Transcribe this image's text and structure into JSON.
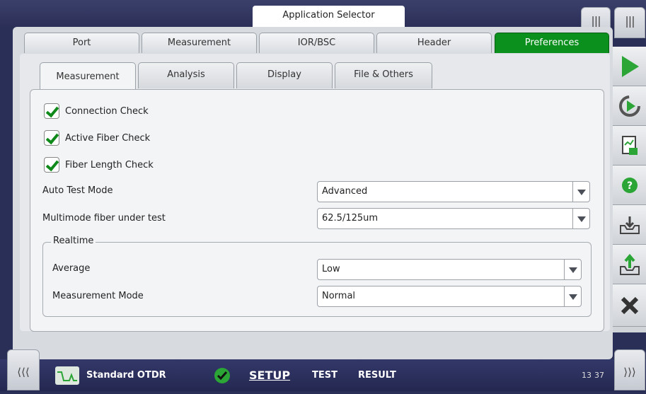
{
  "app_selector": {
    "label": "Application Selector"
  },
  "handles": {
    "top_left": "|||",
    "top_right": "|||",
    "bottom_left": "⟨⟨⟨",
    "bottom_right": "⟩⟩⟩"
  },
  "main_tabs": [
    {
      "label": "Port"
    },
    {
      "label": "Measurement"
    },
    {
      "label": "IOR/BSC"
    },
    {
      "label": "Header"
    },
    {
      "label": "Preferences",
      "active": true
    }
  ],
  "sub_tabs": [
    {
      "label": "Measurement",
      "active": true
    },
    {
      "label": "Analysis"
    },
    {
      "label": "Display"
    },
    {
      "label": "File & Others"
    }
  ],
  "checks": [
    {
      "label": "Connection Check",
      "checked": true
    },
    {
      "label": "Active Fiber Check",
      "checked": true
    },
    {
      "label": "Fiber Length Check",
      "checked": true
    }
  ],
  "auto_test_mode": {
    "label": "Auto Test Mode",
    "value": "Advanced"
  },
  "multimode": {
    "label": "Multimode fiber under test",
    "value": "62.5/125um"
  },
  "realtime": {
    "title": "Realtime",
    "average": {
      "label": "Average",
      "value": "Low"
    },
    "measurement_mode": {
      "label": "Measurement Mode",
      "value": "Normal"
    }
  },
  "right_toolbar": [
    "play-icon",
    "refresh-play-icon",
    "report-icon",
    "help-icon",
    "load-icon",
    "save-icon",
    "close-icon"
  ],
  "bottom": {
    "app_name": "Standard OTDR",
    "setup": "SETUP",
    "test": "TEST",
    "result": "RESULT",
    "time_h": "13",
    "time_m": "37"
  },
  "colors": {
    "accent_green": "#0b8f1d",
    "background": "#2a2f57"
  }
}
